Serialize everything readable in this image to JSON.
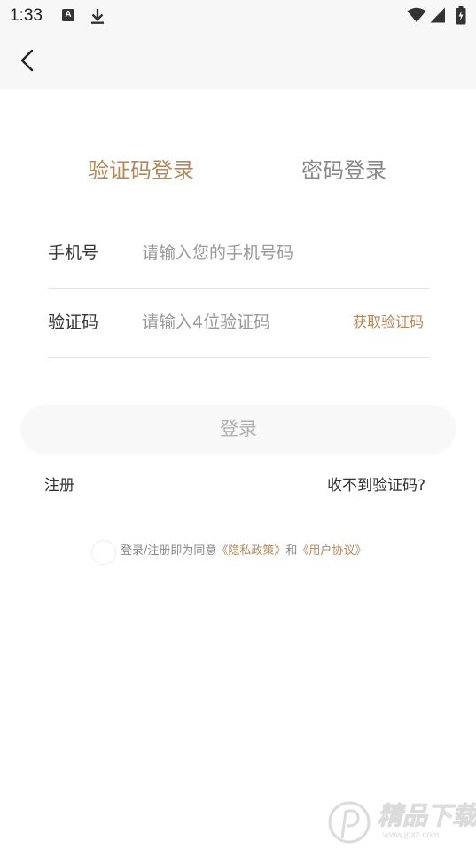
{
  "status_bar": {
    "time": "1:33",
    "a_icon_letter": "A",
    "icons": [
      "a-icon",
      "download-icon",
      "wifi-icon",
      "signal-icon",
      "battery-charging-icon"
    ]
  },
  "nav": {
    "back_icon": "chevron-left-icon"
  },
  "tabs": [
    {
      "label": "验证码登录",
      "active": true
    },
    {
      "label": "密码登录",
      "active": false
    }
  ],
  "form": {
    "phone": {
      "label": "手机号",
      "placeholder": "请输入您的手机号码",
      "value": ""
    },
    "code": {
      "label": "验证码",
      "placeholder": "请输入4位验证码",
      "value": "",
      "get_code_label": "获取验证码"
    }
  },
  "login_button": "登录",
  "links": {
    "register": "注册",
    "no_code": "收不到验证码?"
  },
  "agreement": {
    "checked": false,
    "prefix": "登录/注册即为同意",
    "privacy": "《隐私政策》",
    "conjunction": "和",
    "user_agreement": "《用户协议》"
  },
  "watermark": {
    "text": "精品下载",
    "url": "www.jpxz.com"
  },
  "colors": {
    "accent": "#b4875a",
    "inactive_tab": "#888888",
    "placeholder": "#999999",
    "top_bar_bg": "#f7f7f7",
    "button_bg": "#f8f8f8",
    "button_text": "#b0b0b0"
  }
}
